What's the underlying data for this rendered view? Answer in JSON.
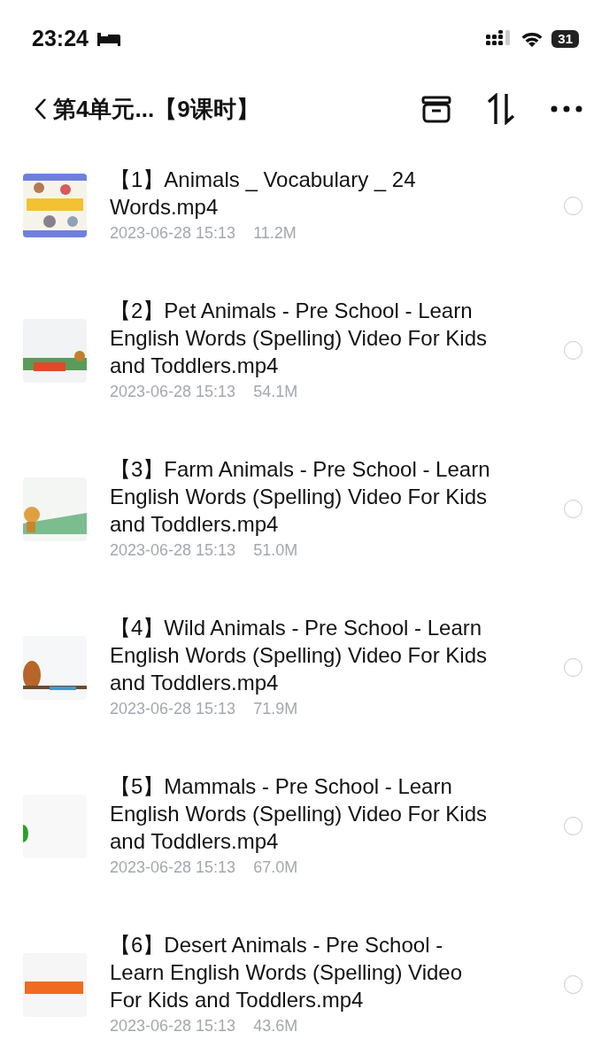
{
  "status_bar": {
    "time": "23:24",
    "battery": "31"
  },
  "header": {
    "title": "第4单元...【9课时】"
  },
  "files": [
    {
      "name": "【1】Animals _ Vocabulary _ 24 Words.mp4",
      "date": "2023-06-28 15:13",
      "size": "11.2M",
      "selected": false
    },
    {
      "name": "【2】Pet Animals - Pre School - Learn English Words (Spelling) Video For Kids and Toddlers.mp4",
      "date": "2023-06-28 15:13",
      "size": "54.1M",
      "selected": false
    },
    {
      "name": "【3】Farm Animals - Pre School - Learn English Words (Spelling) Video For Kids and Toddlers.mp4",
      "date": "2023-06-28 15:13",
      "size": "51.0M",
      "selected": false
    },
    {
      "name": "【4】Wild Animals - Pre School - Learn English Words (Spelling) Video For Kids and Toddlers.mp4",
      "date": "2023-06-28 15:13",
      "size": "71.9M",
      "selected": false
    },
    {
      "name": "【5】Mammals - Pre School - Learn English Words (Spelling) Video For Kids and Toddlers.mp4",
      "date": "2023-06-28 15:13",
      "size": "67.0M",
      "selected": false
    },
    {
      "name": "【6】Desert Animals - Pre School - Learn English Words (Spelling) Video For Kids and Toddlers.mp4",
      "date": "2023-06-28 15:13",
      "size": "43.6M",
      "selected": false
    }
  ]
}
